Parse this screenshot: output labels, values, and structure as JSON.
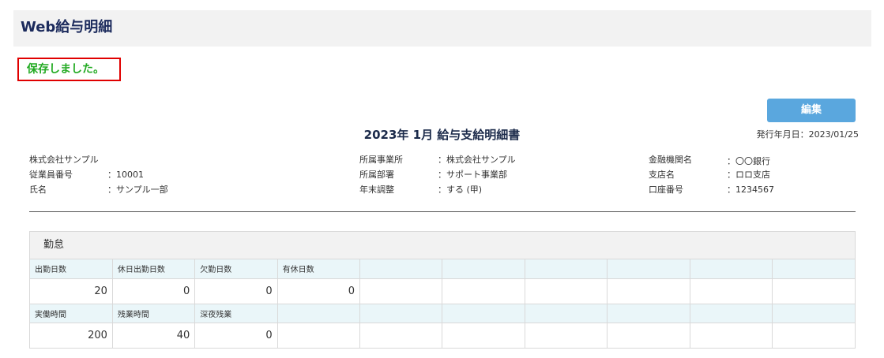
{
  "header": {
    "title": "Web給与明細"
  },
  "status": {
    "message": "保存しました。"
  },
  "toolbar": {
    "edit_label": "編集"
  },
  "document": {
    "title": "2023年 1月 給与支給明細書",
    "issue_date": "発行年月日：2023/01/25"
  },
  "employee": {
    "company": "株式会社サンプル",
    "employee_no_label": "従業員番号",
    "employee_no": "：10001",
    "name_label": "氏名",
    "name": "：サンプル一部"
  },
  "office": {
    "office_label": "所属事業所",
    "office": "：株式会社サンプル",
    "dept_label": "所属部署",
    "dept": "：サポート事業部",
    "year_end_label": "年末調整",
    "year_end": "：する (甲)"
  },
  "bank": {
    "bank_label": "金融機関名",
    "bank": "：〇〇銀行",
    "branch_label": "支店名",
    "branch": "：ロロ支店",
    "account_label": "口座番号",
    "account": "：1234567"
  },
  "attendance": {
    "title": "勤怠",
    "row1_labels": [
      "出勤日数",
      "休日出勤日数",
      "欠勤日数",
      "有休日数",
      "",
      "",
      "",
      "",
      "",
      ""
    ],
    "row1_values": [
      "20",
      "0",
      "0",
      "0",
      "",
      "",
      "",
      "",
      "",
      ""
    ],
    "row2_labels": [
      "実働時間",
      "残業時間",
      "深夜残業",
      "",
      "",
      "",
      "",
      "",
      "",
      ""
    ],
    "row2_values": [
      "200",
      "40",
      "0",
      "",
      "",
      "",
      "",
      "",
      "",
      ""
    ]
  }
}
